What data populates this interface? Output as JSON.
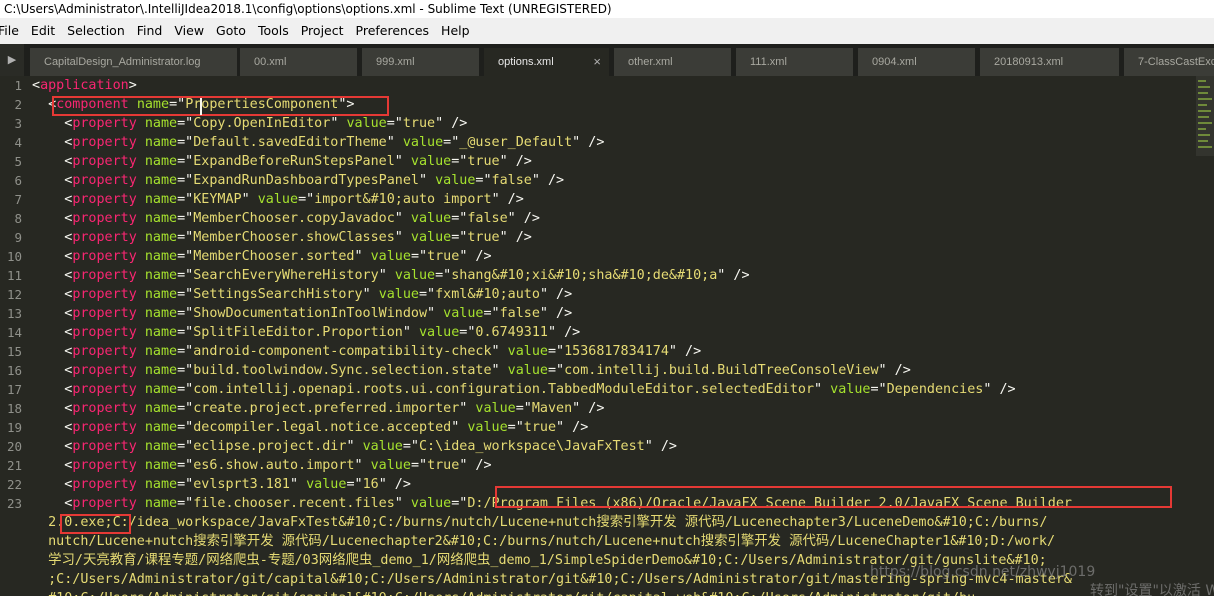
{
  "window": {
    "title": "C:\\Users\\Administrator\\.IntelliJIdea2018.1\\config\\options\\options.xml - Sublime Text (UNREGISTERED)"
  },
  "menu": [
    "File",
    "Edit",
    "Selection",
    "Find",
    "View",
    "Goto",
    "Tools",
    "Project",
    "Preferences",
    "Help"
  ],
  "tabs": [
    {
      "label": "CapitalDesign_Administrator.log",
      "active": false
    },
    {
      "label": "00.xml",
      "active": false
    },
    {
      "label": "999.xml",
      "active": false
    },
    {
      "label": "options.xml",
      "active": true
    },
    {
      "label": "other.xml",
      "active": false
    },
    {
      "label": "111.xml",
      "active": false
    },
    {
      "label": "0904.xml",
      "active": false
    },
    {
      "label": "20180913.xml",
      "active": false
    },
    {
      "label": "7-ClassCastExc",
      "active": false
    }
  ],
  "close_glyph": "×",
  "line_numbers": [
    "1",
    "2",
    "3",
    "4",
    "5",
    "6",
    "7",
    "8",
    "9",
    "10",
    "11",
    "12",
    "13",
    "14",
    "15",
    "16",
    "17",
    "18",
    "19",
    "20",
    "21",
    "22",
    "23",
    "",
    "",
    "",
    "",
    ""
  ],
  "lines": [
    [
      [
        "p",
        "<"
      ],
      [
        "t",
        "application"
      ],
      [
        "p",
        ">"
      ]
    ],
    [
      [
        "p",
        "  <"
      ],
      [
        "t",
        "component"
      ],
      [
        "p",
        " "
      ],
      [
        "a",
        "name"
      ],
      [
        "p",
        "=\""
      ],
      [
        "v",
        "PropertiesComponent"
      ],
      [
        "p",
        "\">"
      ]
    ],
    [
      [
        "p",
        "    <"
      ],
      [
        "t",
        "property"
      ],
      [
        "p",
        " "
      ],
      [
        "a",
        "name"
      ],
      [
        "p",
        "=\""
      ],
      [
        "v",
        "Copy.OpenInEditor"
      ],
      [
        "p",
        "\" "
      ],
      [
        "a",
        "value"
      ],
      [
        "p",
        "=\""
      ],
      [
        "v",
        "true"
      ],
      [
        "p",
        "\" />"
      ]
    ],
    [
      [
        "p",
        "    <"
      ],
      [
        "t",
        "property"
      ],
      [
        "p",
        " "
      ],
      [
        "a",
        "name"
      ],
      [
        "p",
        "=\""
      ],
      [
        "v",
        "Default.savedEditorTheme"
      ],
      [
        "p",
        "\" "
      ],
      [
        "a",
        "value"
      ],
      [
        "p",
        "=\""
      ],
      [
        "v",
        "_@user_Default"
      ],
      [
        "p",
        "\" />"
      ]
    ],
    [
      [
        "p",
        "    <"
      ],
      [
        "t",
        "property"
      ],
      [
        "p",
        " "
      ],
      [
        "a",
        "name"
      ],
      [
        "p",
        "=\""
      ],
      [
        "v",
        "ExpandBeforeRunStepsPanel"
      ],
      [
        "p",
        "\" "
      ],
      [
        "a",
        "value"
      ],
      [
        "p",
        "=\""
      ],
      [
        "v",
        "true"
      ],
      [
        "p",
        "\" />"
      ]
    ],
    [
      [
        "p",
        "    <"
      ],
      [
        "t",
        "property"
      ],
      [
        "p",
        " "
      ],
      [
        "a",
        "name"
      ],
      [
        "p",
        "=\""
      ],
      [
        "v",
        "ExpandRunDashboardTypesPanel"
      ],
      [
        "p",
        "\" "
      ],
      [
        "a",
        "value"
      ],
      [
        "p",
        "=\""
      ],
      [
        "v",
        "false"
      ],
      [
        "p",
        "\" />"
      ]
    ],
    [
      [
        "p",
        "    <"
      ],
      [
        "t",
        "property"
      ],
      [
        "p",
        " "
      ],
      [
        "a",
        "name"
      ],
      [
        "p",
        "=\""
      ],
      [
        "v",
        "KEYMAP"
      ],
      [
        "p",
        "\" "
      ],
      [
        "a",
        "value"
      ],
      [
        "p",
        "=\""
      ],
      [
        "v",
        "import&#10;auto import"
      ],
      [
        "p",
        "\" />"
      ]
    ],
    [
      [
        "p",
        "    <"
      ],
      [
        "t",
        "property"
      ],
      [
        "p",
        " "
      ],
      [
        "a",
        "name"
      ],
      [
        "p",
        "=\""
      ],
      [
        "v",
        "MemberChooser.copyJavadoc"
      ],
      [
        "p",
        "\" "
      ],
      [
        "a",
        "value"
      ],
      [
        "p",
        "=\""
      ],
      [
        "v",
        "false"
      ],
      [
        "p",
        "\" />"
      ]
    ],
    [
      [
        "p",
        "    <"
      ],
      [
        "t",
        "property"
      ],
      [
        "p",
        " "
      ],
      [
        "a",
        "name"
      ],
      [
        "p",
        "=\""
      ],
      [
        "v",
        "MemberChooser.showClasses"
      ],
      [
        "p",
        "\" "
      ],
      [
        "a",
        "value"
      ],
      [
        "p",
        "=\""
      ],
      [
        "v",
        "true"
      ],
      [
        "p",
        "\" />"
      ]
    ],
    [
      [
        "p",
        "    <"
      ],
      [
        "t",
        "property"
      ],
      [
        "p",
        " "
      ],
      [
        "a",
        "name"
      ],
      [
        "p",
        "=\""
      ],
      [
        "v",
        "MemberChooser.sorted"
      ],
      [
        "p",
        "\" "
      ],
      [
        "a",
        "value"
      ],
      [
        "p",
        "=\""
      ],
      [
        "v",
        "true"
      ],
      [
        "p",
        "\" />"
      ]
    ],
    [
      [
        "p",
        "    <"
      ],
      [
        "t",
        "property"
      ],
      [
        "p",
        " "
      ],
      [
        "a",
        "name"
      ],
      [
        "p",
        "=\""
      ],
      [
        "v",
        "SearchEveryWhereHistory"
      ],
      [
        "p",
        "\" "
      ],
      [
        "a",
        "value"
      ],
      [
        "p",
        "=\""
      ],
      [
        "v",
        "shang&#10;xi&#10;sha&#10;de&#10;a"
      ],
      [
        "p",
        "\" />"
      ]
    ],
    [
      [
        "p",
        "    <"
      ],
      [
        "t",
        "property"
      ],
      [
        "p",
        " "
      ],
      [
        "a",
        "name"
      ],
      [
        "p",
        "=\""
      ],
      [
        "v",
        "SettingsSearchHistory"
      ],
      [
        "p",
        "\" "
      ],
      [
        "a",
        "value"
      ],
      [
        "p",
        "=\""
      ],
      [
        "v",
        "fxml&#10;auto"
      ],
      [
        "p",
        "\" />"
      ]
    ],
    [
      [
        "p",
        "    <"
      ],
      [
        "t",
        "property"
      ],
      [
        "p",
        " "
      ],
      [
        "a",
        "name"
      ],
      [
        "p",
        "=\""
      ],
      [
        "v",
        "ShowDocumentationInToolWindow"
      ],
      [
        "p",
        "\" "
      ],
      [
        "a",
        "value"
      ],
      [
        "p",
        "=\""
      ],
      [
        "v",
        "false"
      ],
      [
        "p",
        "\" />"
      ]
    ],
    [
      [
        "p",
        "    <"
      ],
      [
        "t",
        "property"
      ],
      [
        "p",
        " "
      ],
      [
        "a",
        "name"
      ],
      [
        "p",
        "=\""
      ],
      [
        "v",
        "SplitFileEditor.Proportion"
      ],
      [
        "p",
        "\" "
      ],
      [
        "a",
        "value"
      ],
      [
        "p",
        "=\""
      ],
      [
        "v",
        "0.6749311"
      ],
      [
        "p",
        "\" />"
      ]
    ],
    [
      [
        "p",
        "    <"
      ],
      [
        "t",
        "property"
      ],
      [
        "p",
        " "
      ],
      [
        "a",
        "name"
      ],
      [
        "p",
        "=\""
      ],
      [
        "v",
        "android-component-compatibility-check"
      ],
      [
        "p",
        "\" "
      ],
      [
        "a",
        "value"
      ],
      [
        "p",
        "=\""
      ],
      [
        "v",
        "1536817834174"
      ],
      [
        "p",
        "\" />"
      ]
    ],
    [
      [
        "p",
        "    <"
      ],
      [
        "t",
        "property"
      ],
      [
        "p",
        " "
      ],
      [
        "a",
        "name"
      ],
      [
        "p",
        "=\""
      ],
      [
        "v",
        "build.toolwindow.Sync.selection.state"
      ],
      [
        "p",
        "\" "
      ],
      [
        "a",
        "value"
      ],
      [
        "p",
        "=\""
      ],
      [
        "v",
        "com.intellij.build.BuildTreeConsoleView"
      ],
      [
        "p",
        "\" />"
      ]
    ],
    [
      [
        "p",
        "    <"
      ],
      [
        "t",
        "property"
      ],
      [
        "p",
        " "
      ],
      [
        "a",
        "name"
      ],
      [
        "p",
        "=\""
      ],
      [
        "v",
        "com.intellij.openapi.roots.ui.configuration.TabbedModuleEditor.selectedEditor"
      ],
      [
        "p",
        "\" "
      ],
      [
        "a",
        "value"
      ],
      [
        "p",
        "=\""
      ],
      [
        "v",
        "Dependencies"
      ],
      [
        "p",
        "\" />"
      ]
    ],
    [
      [
        "p",
        "    <"
      ],
      [
        "t",
        "property"
      ],
      [
        "p",
        " "
      ],
      [
        "a",
        "name"
      ],
      [
        "p",
        "=\""
      ],
      [
        "v",
        "create.project.preferred.importer"
      ],
      [
        "p",
        "\" "
      ],
      [
        "a",
        "value"
      ],
      [
        "p",
        "=\""
      ],
      [
        "v",
        "Maven"
      ],
      [
        "p",
        "\" />"
      ]
    ],
    [
      [
        "p",
        "    <"
      ],
      [
        "t",
        "property"
      ],
      [
        "p",
        " "
      ],
      [
        "a",
        "name"
      ],
      [
        "p",
        "=\""
      ],
      [
        "v",
        "decompiler.legal.notice.accepted"
      ],
      [
        "p",
        "\" "
      ],
      [
        "a",
        "value"
      ],
      [
        "p",
        "=\""
      ],
      [
        "v",
        "true"
      ],
      [
        "p",
        "\" />"
      ]
    ],
    [
      [
        "p",
        "    <"
      ],
      [
        "t",
        "property"
      ],
      [
        "p",
        " "
      ],
      [
        "a",
        "name"
      ],
      [
        "p",
        "=\""
      ],
      [
        "v",
        "eclipse.project.dir"
      ],
      [
        "p",
        "\" "
      ],
      [
        "a",
        "value"
      ],
      [
        "p",
        "=\""
      ],
      [
        "v",
        "C:\\idea_workspace\\JavaFxTest"
      ],
      [
        "p",
        "\" />"
      ]
    ],
    [
      [
        "p",
        "    <"
      ],
      [
        "t",
        "property"
      ],
      [
        "p",
        " "
      ],
      [
        "a",
        "name"
      ],
      [
        "p",
        "=\""
      ],
      [
        "v",
        "es6.show.auto.import"
      ],
      [
        "p",
        "\" "
      ],
      [
        "a",
        "value"
      ],
      [
        "p",
        "=\""
      ],
      [
        "v",
        "true"
      ],
      [
        "p",
        "\" />"
      ]
    ],
    [
      [
        "p",
        "    <"
      ],
      [
        "t",
        "property"
      ],
      [
        "p",
        " "
      ],
      [
        "a",
        "name"
      ],
      [
        "p",
        "=\""
      ],
      [
        "v",
        "evlsprt3.181"
      ],
      [
        "p",
        "\" "
      ],
      [
        "a",
        "value"
      ],
      [
        "p",
        "=\""
      ],
      [
        "v",
        "16"
      ],
      [
        "p",
        "\" />"
      ]
    ],
    [
      [
        "p",
        "    <"
      ],
      [
        "t",
        "property"
      ],
      [
        "p",
        " "
      ],
      [
        "a",
        "name"
      ],
      [
        "p",
        "=\""
      ],
      [
        "v",
        "file.chooser.recent.files"
      ],
      [
        "p",
        "\" "
      ],
      [
        "a",
        "value"
      ],
      [
        "p",
        "=\""
      ],
      [
        "v",
        "D:/Program Files (x86)/Oracle/JavaFX Scene Builder 2.0/JavaFX Scene Builder"
      ]
    ],
    [
      [
        "v",
        "  2.0.exe;C:/idea_workspace/JavaFxTest&#10;C:/burns/nutch/Lucene+nutch搜索引擎开发 源代码/Lucenechapter3/LuceneDemo&#10;C:/burns/"
      ]
    ],
    [
      [
        "v",
        "  nutch/Lucene+nutch搜索引擎开发 源代码/Lucenechapter2&#10;C:/burns/nutch/Lucene+nutch搜索引擎开发 源代码/LuceneChapter1&#10;D:/work/"
      ]
    ],
    [
      [
        "v",
        "  学习/天亮教育/课程专题/网络爬虫-专题/03网络爬虫_demo_1/网络爬虫_demo_1/SimpleSpiderDemo&#10;C:/Users/Administrator/git/gunslite&#10;"
      ]
    ],
    [
      [
        "v",
        "  ;C:/Users/Administrator/git/capital&#10;C:/Users/Administrator/git&#10;C:/Users/Administrator/git/mastering-spring-mvc4-master&"
      ]
    ],
    [
      [
        "v",
        "  #10;C:/Users/Administrator/git/capital&#10;C:/Users/Administrator/git/capital-web&#10;C:/Users/Administrator/git/bu"
      ]
    ]
  ],
  "watermark": {
    "line1": "https://blog.csdn.net/zhwyj1019",
    "line2": "转到\"设置\"以激活 Windows"
  },
  "colors": {
    "background": "#272822",
    "tag": "#f92672",
    "attribute": "#a6e22e",
    "string": "#e6db74",
    "highlight_box": "#e53935"
  }
}
